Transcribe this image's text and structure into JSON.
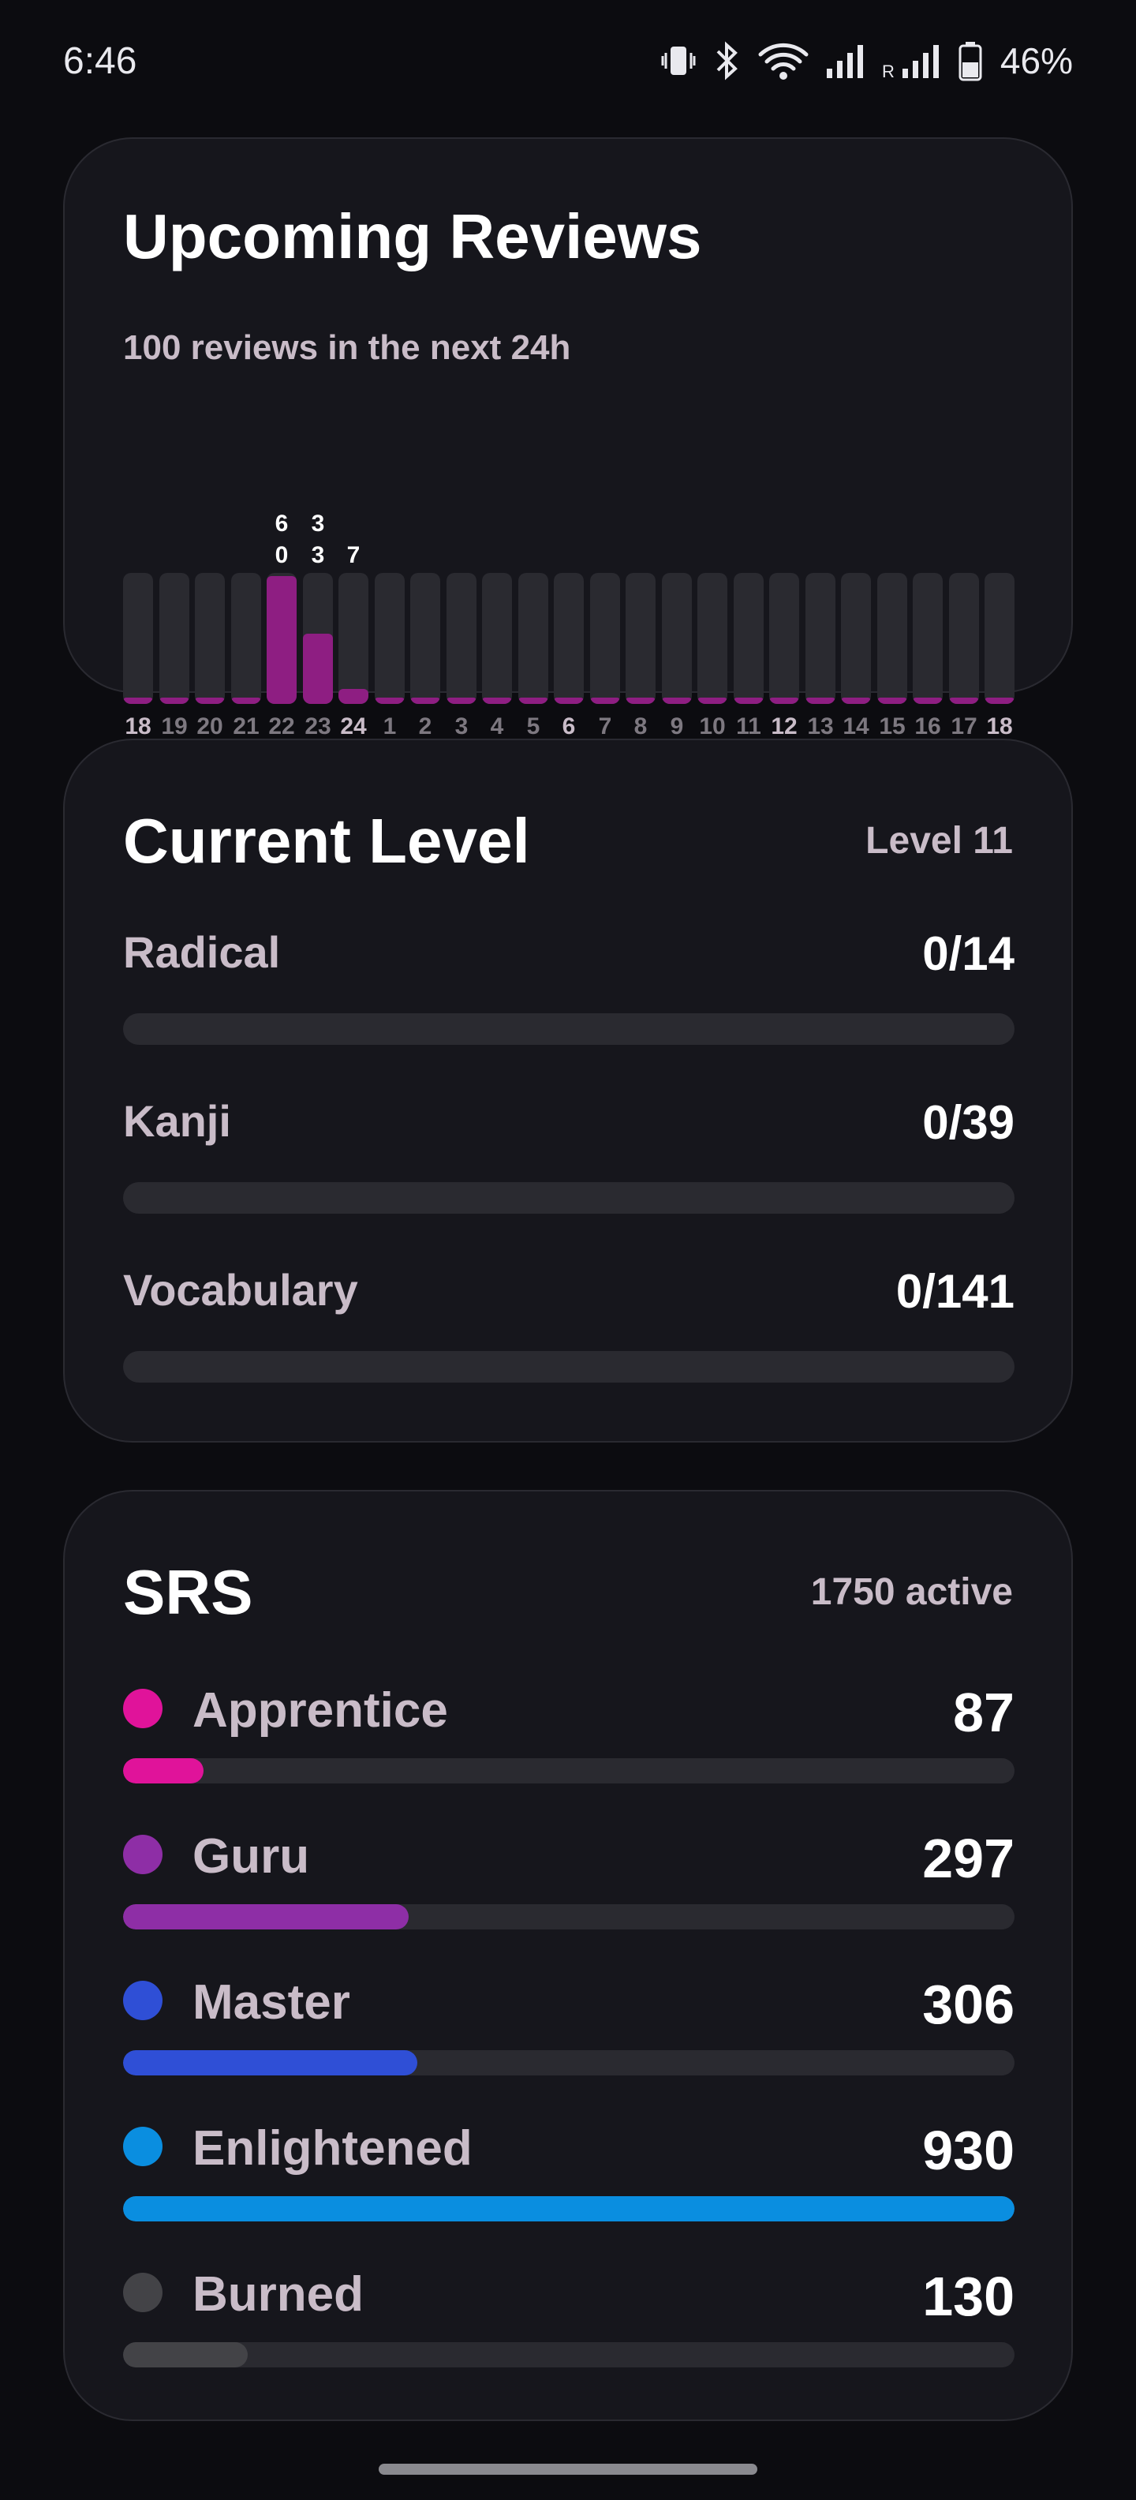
{
  "status_bar": {
    "time": "6:46",
    "roaming": "R",
    "battery": "46%",
    "icons": [
      "vibrate-icon",
      "bluetooth-icon",
      "wifi-icon",
      "signal-icon",
      "signal-roaming-icon",
      "battery-icon"
    ]
  },
  "upcoming": {
    "title": "Upcoming Reviews",
    "subtitle": "100 reviews in the next 24h",
    "bar_color": "#8e1e82",
    "hours": [
      "18",
      "19",
      "20",
      "21",
      "22",
      "23",
      "24",
      "1",
      "2",
      "3",
      "4",
      "5",
      "6",
      "7",
      "8",
      "9",
      "10",
      "11",
      "12",
      "13",
      "14",
      "15",
      "16",
      "17",
      "18"
    ],
    "bright_hours": [
      0,
      6,
      12,
      18,
      24
    ],
    "counts": [
      "",
      "",
      "",
      "",
      "60",
      "33",
      "7",
      "",
      "",
      "",
      "",
      "",
      "",
      "",
      "",
      "",
      "",
      "",
      "",
      "",
      "",
      "",
      "",
      "",
      ""
    ],
    "values": [
      0,
      0,
      0,
      0,
      60,
      33,
      7,
      0,
      0,
      0,
      0,
      0,
      0,
      0,
      0,
      0,
      0,
      0,
      0,
      0,
      0,
      0,
      0,
      0,
      0
    ]
  },
  "current_level": {
    "title": "Current Level",
    "level_text": "Level 11",
    "items": [
      {
        "label": "Radical",
        "value": "0/14"
      },
      {
        "label": "Kanji",
        "value": "0/39"
      },
      {
        "label": "Vocabulary",
        "value": "0/141"
      }
    ]
  },
  "srs": {
    "title": "SRS",
    "active_text": "1750 active",
    "stages": [
      {
        "label": "Apprentice",
        "value": "87",
        "color": "#e0139a",
        "fill": 0.09
      },
      {
        "label": "Guru",
        "value": "297",
        "color": "#8e2ea6",
        "fill": 0.32
      },
      {
        "label": "Master",
        "value": "306",
        "color": "#2f4fd6",
        "fill": 0.33
      },
      {
        "label": "Enlightened",
        "value": "930",
        "color": "#0a8ee0",
        "fill": 1.0
      },
      {
        "label": "Burned",
        "value": "130",
        "color": "#434347",
        "fill": 0.14
      }
    ]
  }
}
